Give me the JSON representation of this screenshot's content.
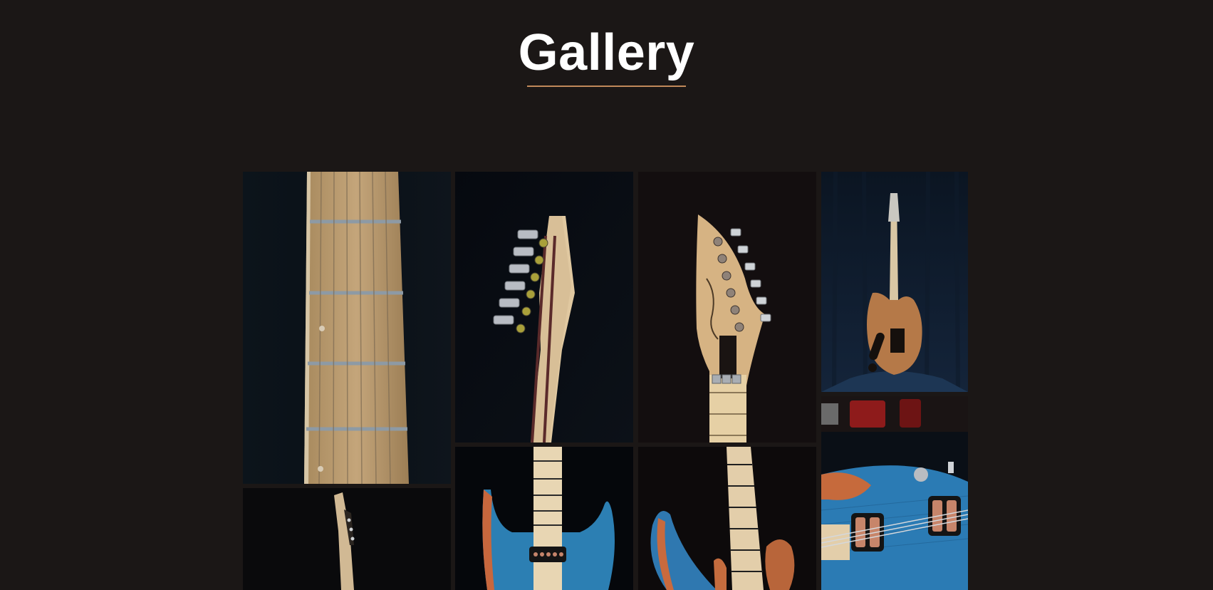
{
  "page": {
    "title": "Gallery",
    "accent_color": "#c1895a",
    "background_color": "#1b1716"
  },
  "gallery": {
    "columns": 4,
    "items": [
      {
        "subject": "fretboard-closeup",
        "tone": "birdseye-maple"
      },
      {
        "subject": "headstock-back",
        "tone": "maple-with-stripes"
      },
      {
        "subject": "headstock-front",
        "tone": "maple-with-logo"
      },
      {
        "subject": "guitar-back-full",
        "tone": "natural-wood"
      },
      {
        "subject": "neck-side-profile",
        "tone": "maple"
      },
      {
        "subject": "guitar-body-front",
        "tone": "blue-flame"
      },
      {
        "subject": "guitar-body-angle",
        "tone": "blue-and-natural"
      },
      {
        "subject": "pickups-closeup",
        "tone": "blue-with-copper-pickups"
      }
    ]
  }
}
